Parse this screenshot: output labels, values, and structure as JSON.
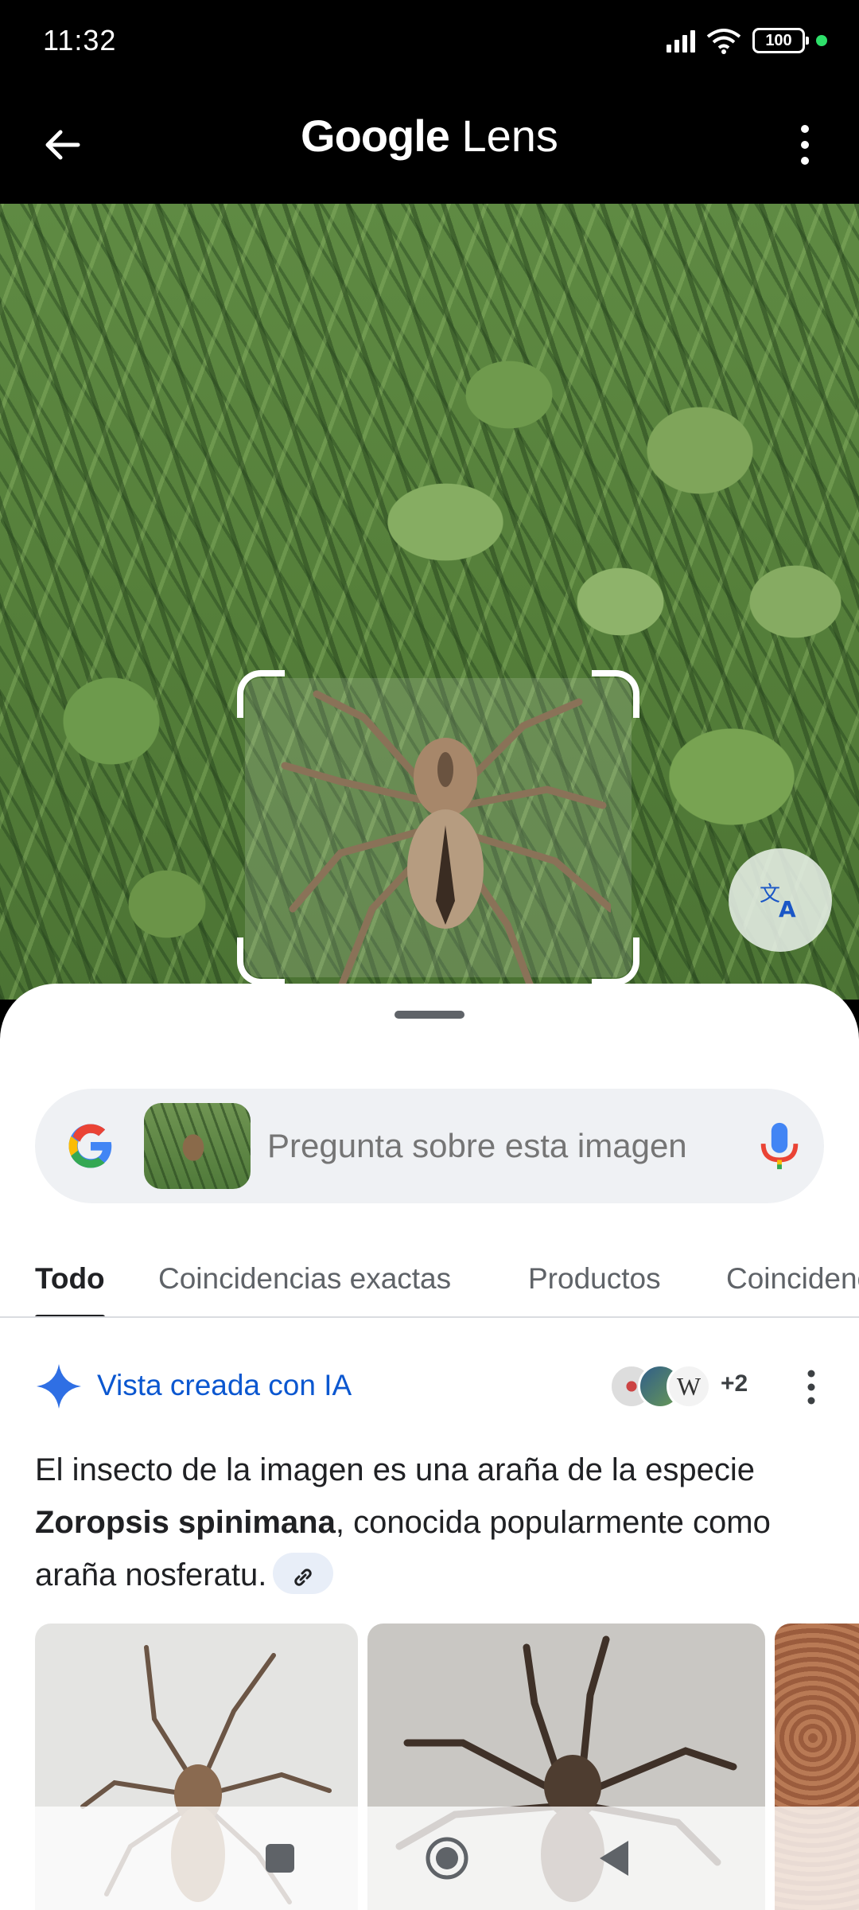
{
  "status_bar": {
    "time": "11:32",
    "battery": "100",
    "icons": [
      "signal-icon",
      "wifi-icon",
      "battery-icon",
      "privacy-dot-icon"
    ]
  },
  "app_bar": {
    "title_brand": "Google",
    "title_product": "Lens",
    "back_icon": "back-arrow-icon",
    "more_icon": "more-vert-icon"
  },
  "image": {
    "crop_selection": "selected region",
    "translate_icon": "translate-icon"
  },
  "search": {
    "placeholder": "Pregunta sobre esta imagen",
    "mic_icon": "mic-icon"
  },
  "tabs": [
    {
      "label": "Todo",
      "active": true
    },
    {
      "label": "Coincidencias exactas",
      "active": false
    },
    {
      "label": "Productos",
      "active": false
    },
    {
      "label": "Coincidencias",
      "active": false
    }
  ],
  "ai_overview": {
    "label": "Vista creada con IA",
    "sources_more": "+2",
    "summary_prefix": "El insecto de la imagen es una araña de la especie ",
    "summary_bold": "Zoropsis spinimana",
    "summary_suffix": ", conocida popularmente como araña nosferatu."
  },
  "colors": {
    "accent_blue": "#0b57d0",
    "text_primary": "#202124",
    "text_secondary": "#5f6368",
    "search_bg": "#eff1f4"
  },
  "nav_bar": {
    "buttons": [
      "recents-icon",
      "home-icon",
      "back-icon"
    ]
  }
}
